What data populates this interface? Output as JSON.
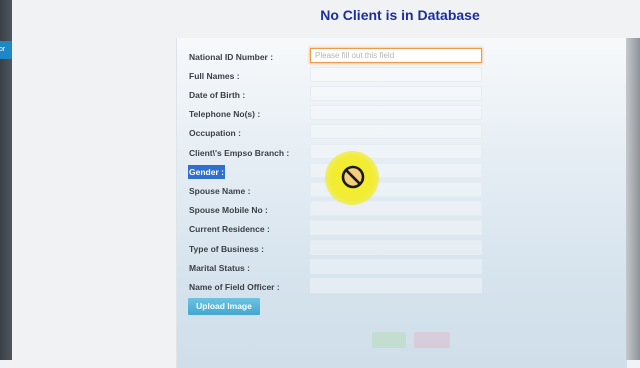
{
  "page": {
    "title": "No Client is in Database",
    "left_tab_text": "or"
  },
  "form": {
    "labels": [
      "National ID Number :",
      "Full Names :",
      "Date of Birth :",
      "Telephone No(s) :",
      "Occupation :",
      "Client\\'s Empso Branch :",
      "Gender :",
      "Spouse Name :",
      "Spouse Mobile No :",
      "Current Residence :",
      "Type of Business :",
      "Marital Status :",
      "Name of Field Officer :"
    ],
    "national_id_placeholder": "Please fill out this field",
    "selected_label": "Gender :",
    "upload_button_label": "Upload Image"
  },
  "icons": {
    "cursor": "not-allowed-icon",
    "cursor_halo_color": "#f2ec33",
    "accent": "#1b2e9e",
    "button_color": "#43a6d0"
  }
}
